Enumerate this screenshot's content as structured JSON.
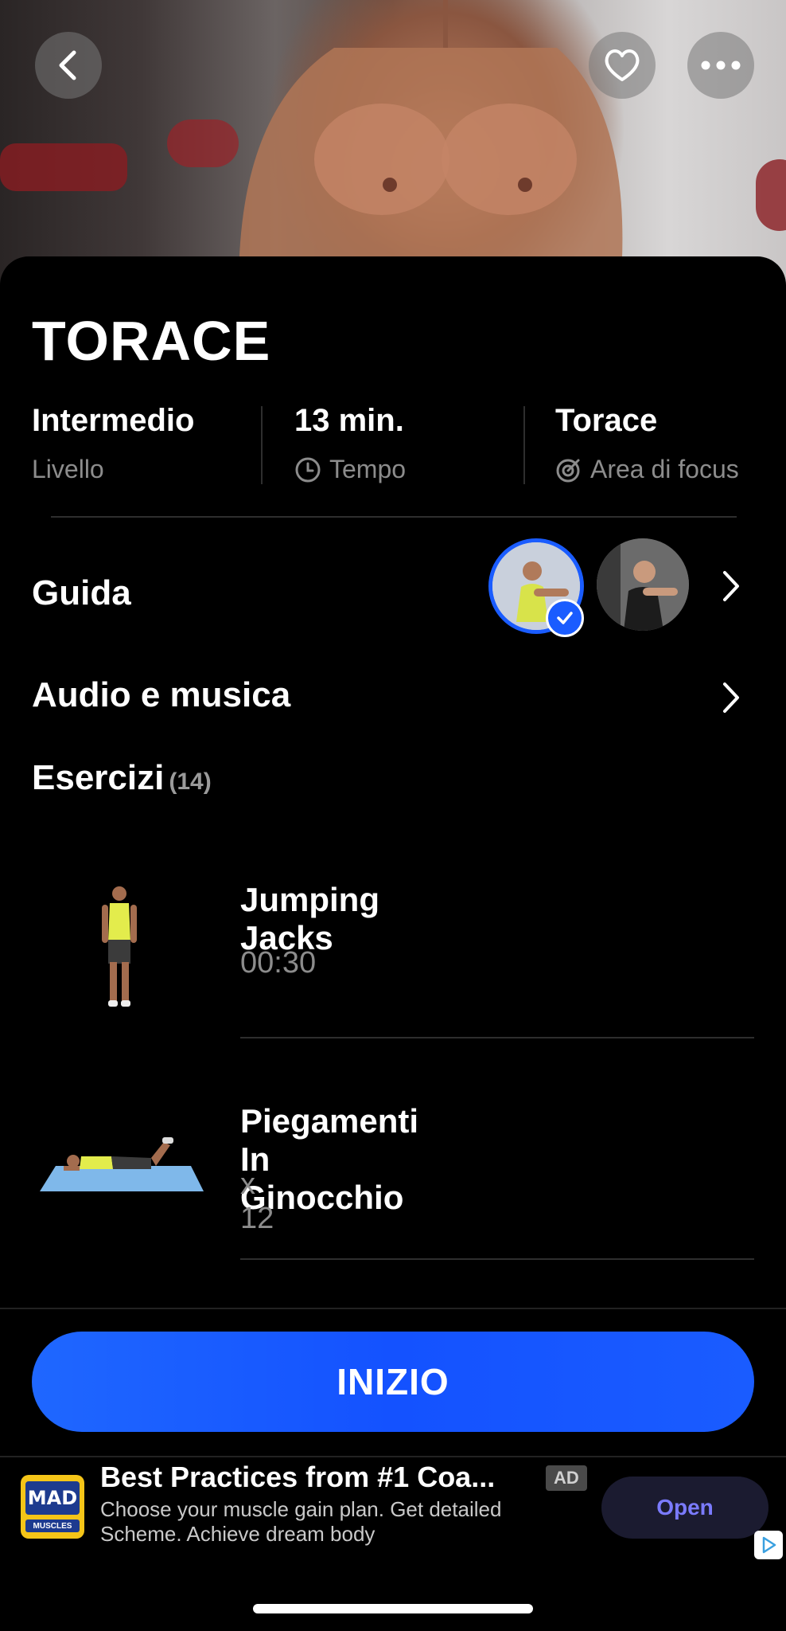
{
  "workout": {
    "title": "TORACE",
    "stats": [
      {
        "value": "Intermedio",
        "label": "Livello",
        "icon": ""
      },
      {
        "value": "13 min.",
        "label": "Tempo",
        "icon": "clock-icon"
      },
      {
        "value": "Torace",
        "label": "Area di focus",
        "icon": "target-icon"
      }
    ]
  },
  "rows": {
    "guide_label": "Guida",
    "audio_label": "Audio e musica"
  },
  "exercises": {
    "title": "Esercizi",
    "count": "(14)",
    "items": [
      {
        "name": "Jumping Jacks",
        "detail": "00:30"
      },
      {
        "name": "Piegamenti In Ginocchio",
        "detail": "x 12"
      }
    ]
  },
  "start_button": "INIZIO",
  "ad": {
    "title": "Best Practices from #1 Coa...",
    "badge": "AD",
    "description": "Choose your muscle gain plan. Get detailed Scheme. Achieve dream body",
    "open_label": "Open",
    "logo_text_top": "MAD",
    "logo_text_bottom": "MUSCLES"
  },
  "colors": {
    "accent": "#1a5cff",
    "background": "#000000",
    "muted_text": "#8c8c8c"
  }
}
